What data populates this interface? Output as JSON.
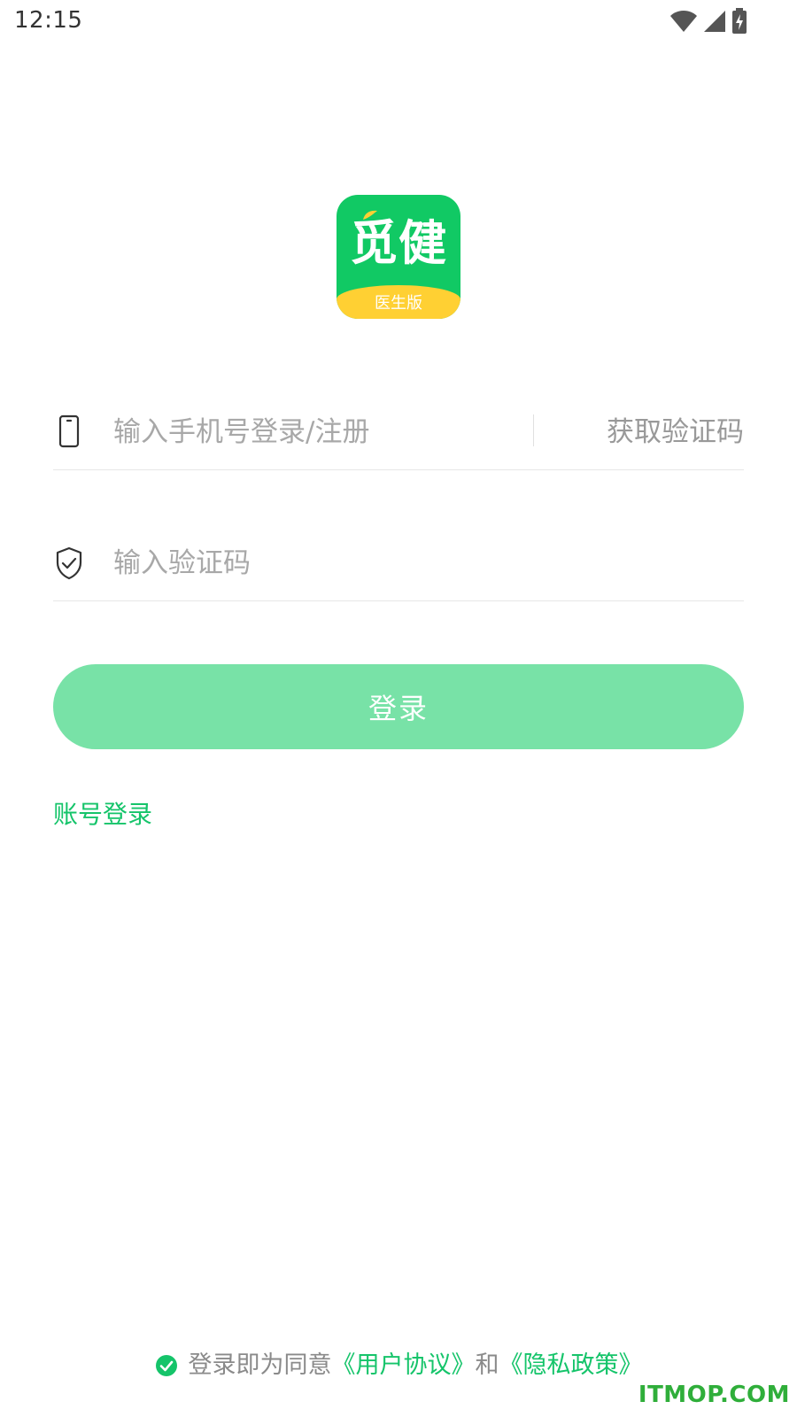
{
  "status_bar": {
    "time": "12:15",
    "icons": [
      "wifi-icon",
      "cellular-signal-icon",
      "battery-charging-icon"
    ]
  },
  "logo": {
    "main_text": "觅健",
    "sub_text": "医生版",
    "colors": {
      "primary": "#11c964",
      "band": "#ffd033"
    }
  },
  "phone_row": {
    "icon": "phone-icon",
    "placeholder": "输入手机号登录/注册",
    "value": "",
    "get_code_label": "获取验证码"
  },
  "code_row": {
    "icon": "shield-check-icon",
    "placeholder": "输入验证码",
    "value": ""
  },
  "login_button": {
    "label": "登录",
    "color": "#78e2a7"
  },
  "account_login_link": "账号登录",
  "agreement": {
    "checked": true,
    "prefix": "登录即为同意",
    "user_agreement": "《用户协议》",
    "conjunction": "和",
    "privacy_policy": "《隐私政策》"
  },
  "theme": {
    "accent": "#15c46a",
    "placeholder": "#a8a8a8"
  },
  "watermark": "ITMOP.COM"
}
